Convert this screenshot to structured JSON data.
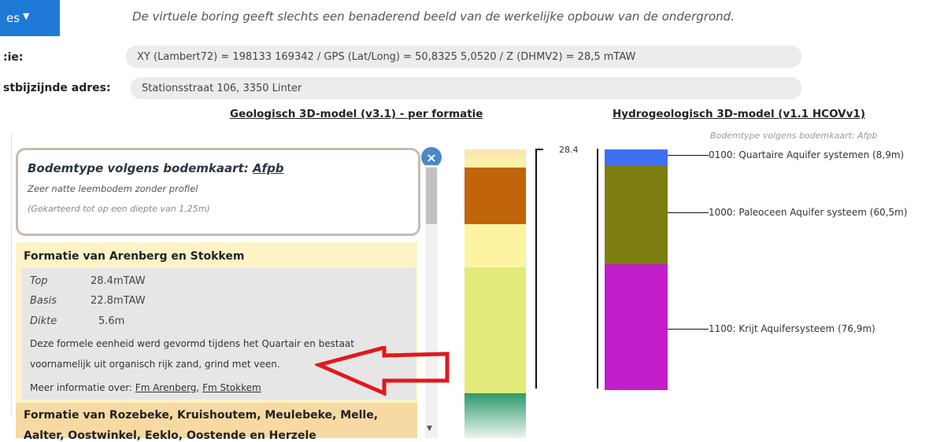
{
  "top_button": {
    "label": "es",
    "icon": "chevron-down-icon"
  },
  "disclaimer": "De virtuele boring geeft slechts een benaderend beeld van de werkelijke opbouw van de ondergrond.",
  "location": {
    "label": ":ie:",
    "value": "XY (Lambert72) = 198133 169342 / GPS (Lat/Long) = 50,8325 5,0520 / Z (DHMV2) = 28,5 mTAW"
  },
  "address": {
    "label": "stbijzijnde adres:",
    "value": "Stationsstraat 106, 3350 Linter"
  },
  "geo_model_title": "Geologisch 3D-model (v3.1) - per formatie",
  "hydro_model_title": "Hydrogeologisch 3D-model (v1.1 HCOVv1)",
  "bodem": {
    "title_prefix": "Bodemtype volgens bodemkaart:",
    "title_code": "Afpb",
    "description": "Zeer natte leembodem zonder profiel",
    "depth": "(Gekarteerd tot op een diepte van 1,25m)"
  },
  "formation1": {
    "title": "Formatie van Arenberg en Stokkem",
    "rows": [
      {
        "key": "Top",
        "value": "28.4mTAW"
      },
      {
        "key": "Basis",
        "value": "22.8mTAW"
      },
      {
        "key": "Dikte",
        "value": "5.6m"
      }
    ],
    "para_line1": "Deze formele eenheid werd gevormd tijdens het Quartair en bestaat",
    "para_line2": "voornamelijk uit organisch rijk zand, grind met veen.",
    "more_prefix": "Meer informatie over:",
    "link1": "Fm Arenberg",
    "sep": ",",
    "link2": "Fm Stokkem"
  },
  "formation2": {
    "title_line1": "Formatie van Rozebeke, Kruishoutem, Meulebeke, Melle,",
    "title_line2": "Aalter, Oostwinkel, Eeklo, Oostende en Herzele"
  },
  "close_icon": "close-icon",
  "depth_top_label": "28.4",
  "hydro_soil_note": "Bodemtype volgens bodemkaart: Afpb",
  "hydro_units": [
    {
      "label": "0100: Quartaire Aquifer systemen (8,9m)",
      "color": "#3f6ff0"
    },
    {
      "label": "1000: Paleoceen Aquifer systeem (60,5m)",
      "color": "#7d7d10"
    },
    {
      "label": "1100: Krijt Aquifersysteem (76,9m)",
      "color": "#c21ec9"
    }
  ],
  "geo_layers": [
    {
      "name": "top-thin",
      "color": "#fae7b0"
    },
    {
      "name": "quartair",
      "color": "#fdf0a8"
    },
    {
      "name": "orange-brown",
      "color": "#c0650a"
    },
    {
      "name": "pale-yellow",
      "color": "#fcf3a3"
    },
    {
      "name": "yellow-green",
      "color": "#e1ea7a"
    },
    {
      "name": "green",
      "color": "#2e9a6a"
    }
  ],
  "arrow_color": "#e0191c"
}
